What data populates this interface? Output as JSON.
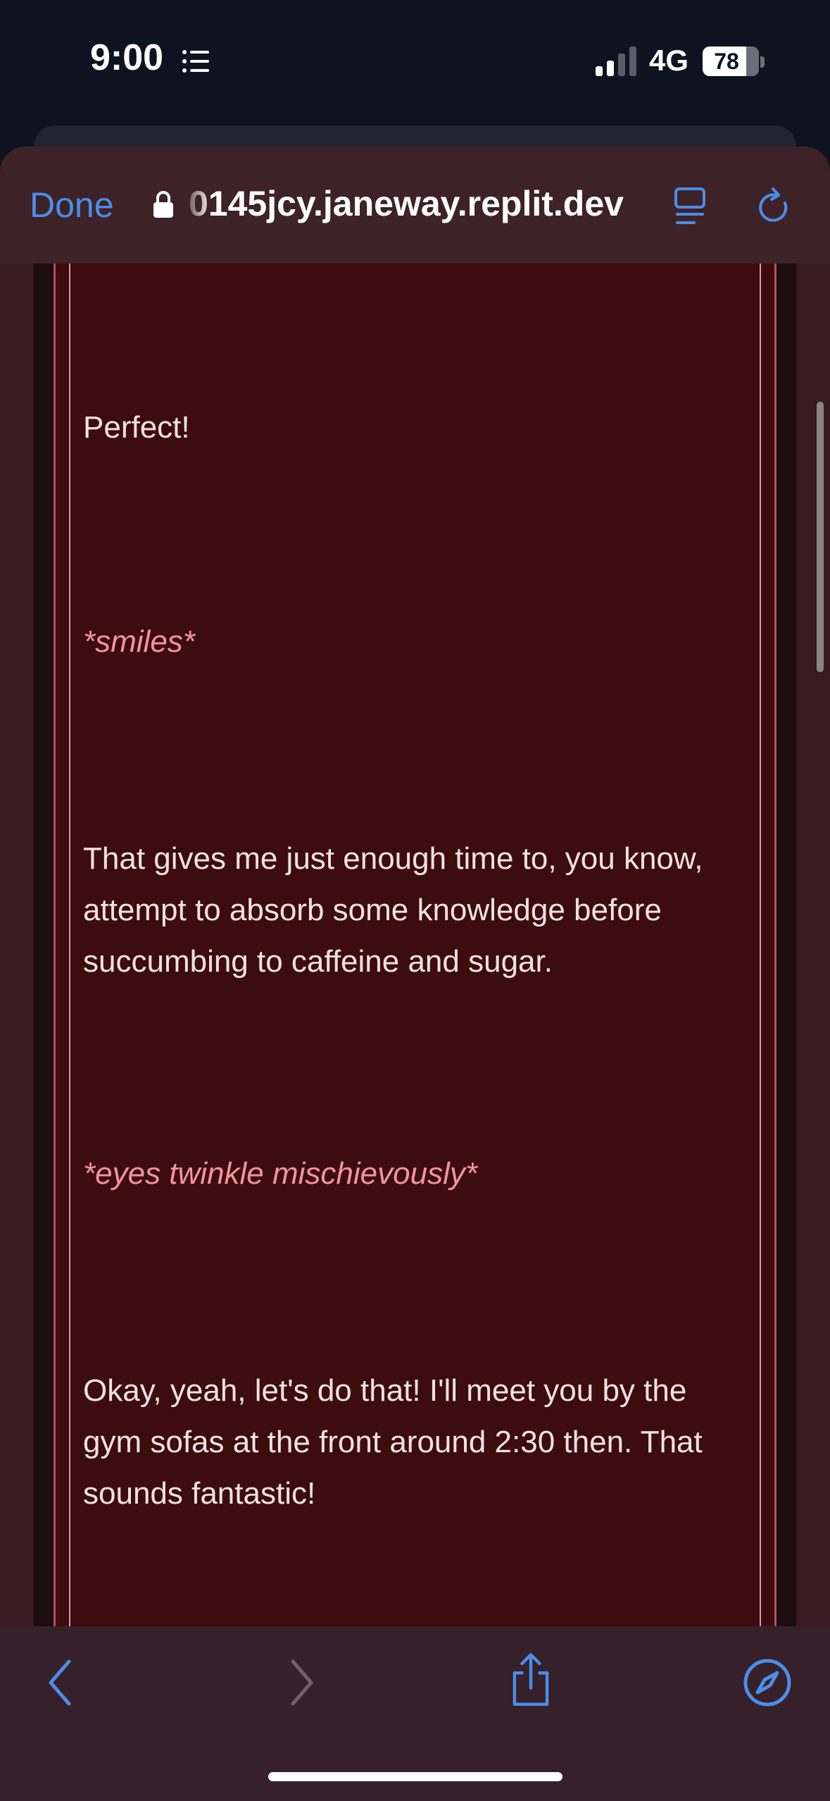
{
  "status_bar": {
    "time": "9:00",
    "network": "4G",
    "battery_level": "78",
    "focus_icon": "list-icon",
    "signal_icon": "cellular-signal-icon"
  },
  "browser": {
    "done_label": "Done",
    "url": "0145jcy.janeway.replit.dev",
    "lock_icon": "lock-icon",
    "reader_icon": "reader-mode-icon",
    "reload_icon": "reload-icon",
    "accent_color": "#4a8ee8"
  },
  "messages": [
    {
      "type": "speech",
      "text": "Perfect!"
    },
    {
      "type": "action",
      "text": "*smiles*"
    },
    {
      "type": "speech",
      "text": "That gives me just enough time to, you know, attempt to absorb some knowledge before succumbing to caffeine and sugar."
    },
    {
      "type": "action",
      "text": "*eyes twinkle mischievously*"
    },
    {
      "type": "speech",
      "text": "Okay, yeah, let's do that! I'll meet you by the gym sofas at the front around 2:30 then. That sounds fantastic!"
    }
  ],
  "toolbar": {
    "back_icon": "chevron-left-icon",
    "forward_icon": "chevron-right-icon",
    "share_icon": "share-icon",
    "safari_icon": "compass-icon"
  },
  "colors": {
    "card_background": "#3d0c0f",
    "page_background": "#381a22",
    "action_text": "#f1949c",
    "speech_text": "#f2e2e2"
  }
}
